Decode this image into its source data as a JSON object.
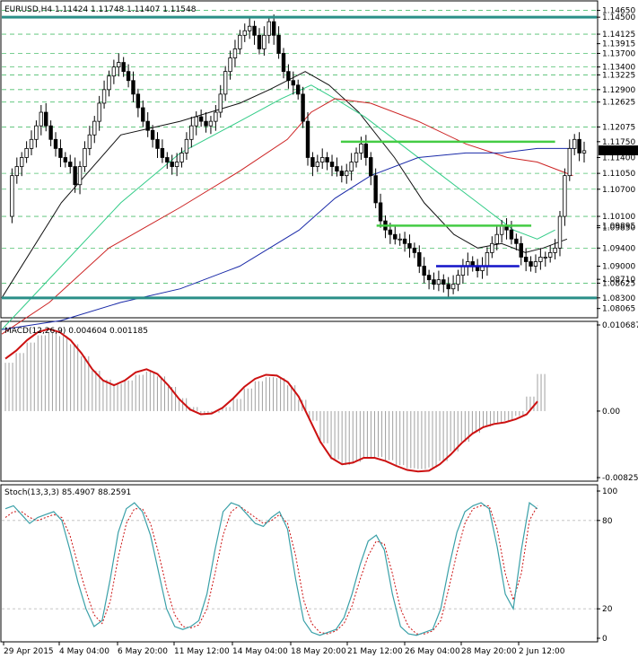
{
  "colors": {
    "candle": "#000000",
    "horizontal_teal": "#2a8f88",
    "horizontal_green": "#44cc44",
    "horizontal_blue": "#1414c8",
    "fib_dash": "#4fbf6f",
    "ma_fast": "#111111",
    "ma_mid": "#33cc88",
    "ma_slow": "#cc2222",
    "ma_long": "#1a2aa8",
    "macd_line": "#cc1111",
    "macd_hist": "#a0a0a0",
    "stoch_main": "#3aa0a8",
    "stoch_signal": "#cc1111",
    "current_price_bg": "#000000",
    "current_price_text": "#ffffff"
  },
  "chart_data": [
    {
      "type": "candlestick",
      "title": "EURUSD,H4  1.11424 1.11748 1.11407 1.11548",
      "ylim": [
        1.079,
        1.148
      ],
      "price_labels": [
        {
          "text": "1.14650",
          "value": 1.1465
        },
        {
          "text": "1.14500",
          "value": 1.145
        },
        {
          "text": "1.14125",
          "value": 1.14125
        },
        {
          "text": "1.13915",
          "value": 1.13915
        },
        {
          "text": "1.13700",
          "value": 1.137
        },
        {
          "text": "1.13400",
          "value": 1.134
        },
        {
          "text": "1.13225",
          "value": 1.13225
        },
        {
          "text": "1.12900",
          "value": 1.129
        },
        {
          "text": "1.12625",
          "value": 1.12625
        },
        {
          "text": "1.12075",
          "value": 1.12075
        },
        {
          "text": "1.11750",
          "value": 1.1175
        },
        {
          "text": "1.11400",
          "value": 1.114
        },
        {
          "text": "1.11050",
          "value": 1.1105
        },
        {
          "text": "1.10700",
          "value": 1.107
        },
        {
          "text": "1.10100",
          "value": 1.101
        },
        {
          "text": "1.09895",
          "value": 1.09895
        },
        {
          "text": "1.09850",
          "value": 1.0985
        },
        {
          "text": "1.09400",
          "value": 1.094
        },
        {
          "text": "1.09000",
          "value": 1.09
        },
        {
          "text": "1.08710",
          "value": 1.0871
        },
        {
          "text": "1.08625",
          "value": 1.08625
        },
        {
          "text": "1.08300",
          "value": 1.083
        },
        {
          "text": "1.08065",
          "value": 1.08065
        }
      ],
      "current_price": {
        "text": "1.11548",
        "value": 1.11548
      },
      "horizontal_lines": [
        {
          "value": 1.145,
          "style": "teal",
          "from": 0.0,
          "to": 1.0
        },
        {
          "value": 1.083,
          "style": "teal",
          "from": 0.0,
          "to": 1.0
        },
        {
          "value": 1.1175,
          "style": "green",
          "from": 0.57,
          "to": 0.93
        },
        {
          "value": 1.09895,
          "style": "green",
          "from": 0.63,
          "to": 0.89
        },
        {
          "value": 1.09,
          "style": "blue",
          "from": 0.73,
          "to": 0.87
        }
      ],
      "fib_levels": [
        1.1465,
        1.14125,
        1.137,
        1.134,
        1.13225,
        1.129,
        1.12625,
        1.12075,
        1.1105,
        1.107,
        1.101,
        1.094,
        1.08625
      ],
      "price_path": [
        1.101,
        1.11,
        1.112,
        1.114,
        1.116,
        1.118,
        1.121,
        1.124,
        1.121,
        1.118,
        1.116,
        1.114,
        1.113,
        1.112,
        1.108,
        1.112,
        1.116,
        1.119,
        1.122,
        1.126,
        1.129,
        1.132,
        1.134,
        1.135,
        1.133,
        1.131,
        1.128,
        1.125,
        1.122,
        1.12,
        1.118,
        1.116,
        1.114,
        1.113,
        1.112,
        1.113,
        1.115,
        1.118,
        1.121,
        1.123,
        1.122,
        1.121,
        1.122,
        1.124,
        1.128,
        1.133,
        1.136,
        1.138,
        1.141,
        1.142,
        1.143,
        1.141,
        1.138,
        1.141,
        1.144,
        1.141,
        1.137,
        1.133,
        1.131,
        1.13,
        1.128,
        1.122,
        1.114,
        1.112,
        1.113,
        1.114,
        1.113,
        1.112,
        1.111,
        1.11,
        1.111,
        1.113,
        1.115,
        1.117,
        1.114,
        1.11,
        1.104,
        1.1,
        1.098,
        1.097,
        1.096,
        1.096,
        1.095,
        1.094,
        1.093,
        1.09,
        1.088,
        1.087,
        1.086,
        1.087,
        1.086,
        1.085,
        1.086,
        1.088,
        1.09,
        1.091,
        1.09,
        1.089,
        1.09,
        1.093,
        1.095,
        1.097,
        1.099,
        1.098,
        1.096,
        1.095,
        1.092,
        1.091,
        1.09,
        1.091,
        1.092,
        1.092,
        1.093,
        1.094,
        1.101,
        1.11,
        1.116,
        1.118,
        1.115,
        1.1155
      ],
      "moving_averages": [
        {
          "style": "ma_fast",
          "points": [
            [
              0.0,
              1.083
            ],
            [
              0.1,
              1.104
            ],
            [
              0.2,
              1.119
            ],
            [
              0.3,
              1.122
            ],
            [
              0.4,
              1.126
            ],
            [
              0.45,
              1.129
            ],
            [
              0.51,
              1.133
            ],
            [
              0.55,
              1.13
            ],
            [
              0.6,
              1.124
            ],
            [
              0.66,
              1.114
            ],
            [
              0.71,
              1.104
            ],
            [
              0.76,
              1.097
            ],
            [
              0.8,
              1.094
            ],
            [
              0.84,
              1.095
            ],
            [
              0.88,
              1.093
            ],
            [
              0.91,
              1.094
            ],
            [
              0.95,
              1.096
            ]
          ]
        },
        {
          "style": "ma_mid",
          "points": [
            [
              0.0,
              1.076
            ],
            [
              0.1,
              1.09
            ],
            [
              0.2,
              1.104
            ],
            [
              0.3,
              1.115
            ],
            [
              0.4,
              1.122
            ],
            [
              0.47,
              1.127
            ],
            [
              0.52,
              1.13
            ],
            [
              0.56,
              1.127
            ],
            [
              0.61,
              1.123
            ],
            [
              0.67,
              1.117
            ],
            [
              0.74,
              1.11
            ],
            [
              0.8,
              1.104
            ],
            [
              0.86,
              1.098
            ],
            [
              0.9,
              1.096
            ],
            [
              0.93,
              1.098
            ]
          ]
        },
        {
          "style": "ma_slow",
          "points": [
            [
              0.0,
              1.075
            ],
            [
              0.08,
              1.082
            ],
            [
              0.18,
              1.094
            ],
            [
              0.3,
              1.103
            ],
            [
              0.4,
              1.111
            ],
            [
              0.48,
              1.118
            ],
            [
              0.52,
              1.124
            ],
            [
              0.56,
              1.127
            ],
            [
              0.62,
              1.126
            ],
            [
              0.7,
              1.122
            ],
            [
              0.78,
              1.117
            ],
            [
              0.85,
              1.114
            ],
            [
              0.9,
              1.113
            ],
            [
              0.94,
              1.111
            ],
            [
              0.96,
              1.11
            ]
          ]
        },
        {
          "style": "ma_long",
          "points": [
            [
              0.0,
              1.076
            ],
            [
              0.1,
              1.078
            ],
            [
              0.2,
              1.082
            ],
            [
              0.3,
              1.085
            ],
            [
              0.4,
              1.09
            ],
            [
              0.5,
              1.098
            ],
            [
              0.56,
              1.105
            ],
            [
              0.62,
              1.11
            ],
            [
              0.7,
              1.114
            ],
            [
              0.78,
              1.115
            ],
            [
              0.84,
              1.115
            ],
            [
              0.9,
              1.116
            ],
            [
              0.96,
              1.116
            ]
          ]
        }
      ]
    },
    {
      "type": "macd",
      "title": "MACD(12,26,9) 0.004604 0.001185",
      "ylim": [
        -0.00825,
        0.010687
      ],
      "tick_labels": [
        {
          "text": "0.010687",
          "value": 0.010687
        },
        {
          "text": "0.00",
          "value": 0.0
        },
        {
          "text": "-0.008254",
          "value": -0.008254
        }
      ],
      "signal_path": [
        0.0065,
        0.0075,
        0.0088,
        0.0098,
        0.0102,
        0.0098,
        0.0088,
        0.0072,
        0.0052,
        0.0038,
        0.0032,
        0.0038,
        0.0048,
        0.0052,
        0.0046,
        0.0032,
        0.0015,
        0.0002,
        -0.0004,
        -0.0003,
        0.0004,
        0.0016,
        0.003,
        0.004,
        0.0045,
        0.0044,
        0.0036,
        0.0018,
        -0.001,
        -0.0038,
        -0.0058,
        -0.0066,
        -0.0064,
        -0.0058,
        -0.0058,
        -0.0062,
        -0.0068,
        -0.0073,
        -0.0075,
        -0.0074,
        -0.0066,
        -0.0054,
        -0.004,
        -0.0028,
        -0.002,
        -0.0016,
        -0.0014,
        -0.001,
        -0.0004,
        0.0012
      ],
      "histogram": [
        0.006,
        0.0072,
        0.0085,
        0.0094,
        0.0098,
        0.0093,
        0.0083,
        0.0068,
        0.005,
        0.0039,
        0.0034,
        0.0038,
        0.0045,
        0.0049,
        0.0043,
        0.003,
        0.0016,
        0.0005,
        -0.0003,
        -0.0002,
        0.0005,
        0.0015,
        0.0028,
        0.0037,
        0.0042,
        0.0041,
        0.0032,
        0.0014,
        -0.0012,
        -0.004,
        -0.006,
        -0.0067,
        -0.0063,
        -0.0057,
        -0.0057,
        -0.0061,
        -0.0067,
        -0.0071,
        -0.0072,
        -0.007,
        -0.0062,
        -0.005,
        -0.0038,
        -0.0027,
        -0.0019,
        -0.0015,
        -0.0012,
        -0.0006,
        0.0018,
        0.0046
      ]
    },
    {
      "type": "stochastic",
      "title": "Stoch(13,3,3) 85.4907 88.2591",
      "ylim": [
        0,
        100
      ],
      "tick_labels": [
        {
          "text": "100",
          "value": 100
        },
        {
          "text": "80",
          "value": 80
        },
        {
          "text": "20",
          "value": 20
        },
        {
          "text": "0",
          "value": 0
        }
      ],
      "main_path": [
        88,
        90,
        84,
        78,
        82,
        84,
        86,
        80,
        60,
        38,
        20,
        8,
        12,
        40,
        72,
        88,
        92,
        86,
        70,
        45,
        20,
        8,
        6,
        8,
        12,
        30,
        60,
        86,
        92,
        90,
        84,
        78,
        76,
        82,
        86,
        74,
        40,
        12,
        4,
        2,
        4,
        6,
        14,
        30,
        50,
        66,
        70,
        60,
        30,
        8,
        3,
        2,
        4,
        6,
        20,
        48,
        72,
        86,
        90,
        92,
        88,
        62,
        30,
        20,
        60,
        92,
        88
      ],
      "signal_path": [
        82,
        86,
        86,
        82,
        80,
        82,
        84,
        82,
        70,
        50,
        32,
        16,
        10,
        25,
        55,
        78,
        88,
        88,
        78,
        58,
        34,
        16,
        8,
        7,
        9,
        20,
        44,
        70,
        86,
        90,
        86,
        82,
        78,
        80,
        84,
        78,
        56,
        26,
        10,
        4,
        3,
        5,
        10,
        22,
        40,
        56,
        66,
        64,
        44,
        20,
        8,
        3,
        3,
        5,
        12,
        34,
        58,
        78,
        88,
        90,
        90,
        74,
        44,
        26,
        44,
        80,
        90
      ]
    }
  ],
  "x_axis": {
    "labels": [
      "29 Apr 2015",
      "4 May 04:00",
      "6 May 20:00",
      "11 May 12:00",
      "14 May 04:00",
      "18 May 20:00",
      "21 May 12:00",
      "26 May 04:00",
      "28 May 20:00",
      "2 Jun 12:00"
    ]
  }
}
